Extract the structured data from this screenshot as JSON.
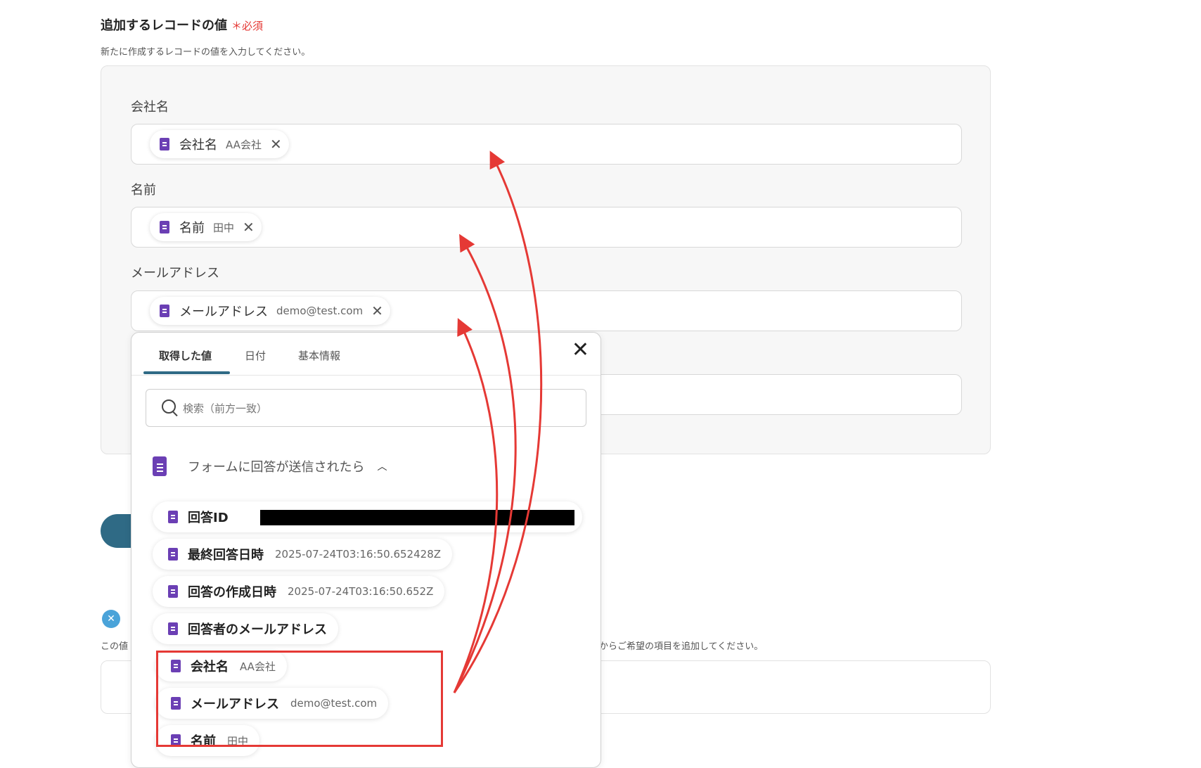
{
  "header": {
    "title": "追加するレコードの値",
    "required_mark": "＊必須",
    "subtitle": "新たに作成するレコードの値を入力してください。"
  },
  "fields": [
    {
      "label": "会社名",
      "chip_name": "会社名",
      "chip_value": "AA会社"
    },
    {
      "label": "名前",
      "chip_name": "名前",
      "chip_value": "田中"
    },
    {
      "label": "メールアドレス",
      "chip_name": "メールアドレス",
      "chip_value": "demo@test.com"
    }
  ],
  "background": {
    "hint_left": "この値",
    "hint_right": "からご希望の項目を追加してください。"
  },
  "popup": {
    "tabs": [
      "取得した値",
      "日付",
      "基本情報"
    ],
    "search_placeholder": "検索（前方一致）",
    "group_title": "フォームに回答が送信されたら",
    "items": [
      {
        "name": "回答ID",
        "value": ""
      },
      {
        "name": "最終回答日時",
        "value": "2025-07-24T03:16:50.652428Z"
      },
      {
        "name": "回答の作成日時",
        "value": "2025-07-24T03:16:50.652Z"
      },
      {
        "name": "回答者のメールアドレス",
        "value": ""
      },
      {
        "name": "会社名",
        "value": "AA会社"
      },
      {
        "name": "メールアドレス",
        "value": "demo@test.com"
      },
      {
        "name": "名前",
        "value": "田中"
      }
    ]
  },
  "colors": {
    "accent": "#2f6a85",
    "required": "#e53935",
    "form_icon": "#6b3fb4",
    "annotation": "#e53935"
  }
}
